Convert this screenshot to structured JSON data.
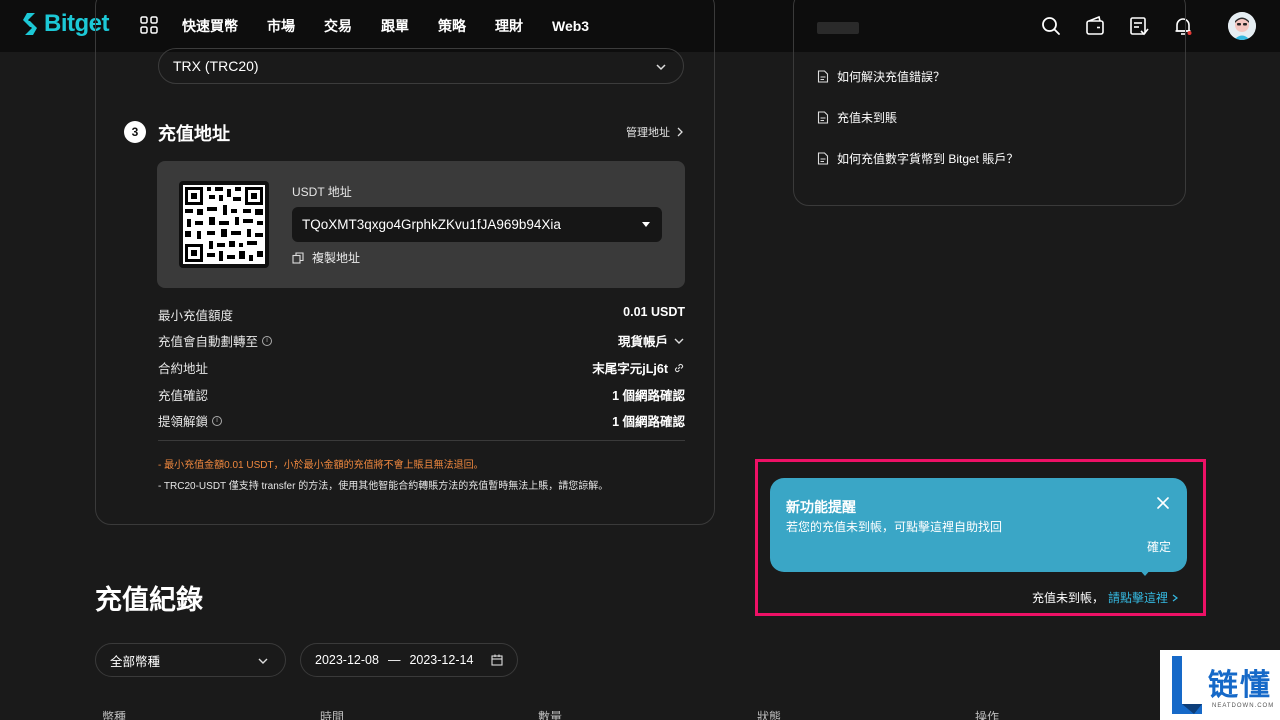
{
  "nav": {
    "logo_text": "Bitget",
    "items": [
      "快速買幣",
      "市場",
      "交易",
      "跟單",
      "策略",
      "理財",
      "Web3"
    ]
  },
  "deposit": {
    "network_value": "TRX (TRC20)",
    "step_number": "3",
    "step_title": "充值地址",
    "manage_link": "管理地址",
    "address_label": "USDT 地址",
    "address_value": "TQoXMT3qxgo4GrphkZKvu1fJA969b94Xia",
    "copy_label": "複製地址",
    "rows": [
      {
        "label": "最小充值額度",
        "value": "0.01 USDT"
      },
      {
        "label": "充值會自動劃轉至",
        "value": "現貨帳戶"
      },
      {
        "label": "合約地址",
        "value": "末尾字元jLj6t"
      },
      {
        "label": "充值確認",
        "value": "1 個網路確認"
      },
      {
        "label": "提領解鎖",
        "value": "1 個網路確認"
      }
    ],
    "note_warning": "- 最小充值金額0.01 USDT，小於最小金額的充值將不會上賬且無法退回。",
    "note_info": "- TRC20-USDT 僅支持 transfer 的方法，使用其他智能合約轉賬方法的充值暫時無法上賬，請您諒解。"
  },
  "faq": {
    "items": [
      "如何解決充值錯誤？",
      "充值未到賬",
      "如何充值數字貨幣到 Bitget 賬戶？"
    ]
  },
  "records": {
    "title": "充值紀錄",
    "coin_filter": "全部幣種",
    "date_start": "2023-12-08",
    "date_sep": "—",
    "date_end": "2023-12-14",
    "columns": [
      "幣種",
      "時間",
      "數量",
      "狀態",
      "操作"
    ]
  },
  "popover": {
    "title": "新功能提醒",
    "body": "若您的充值未到帳，可點擊這裡自助找回",
    "confirm": "確定",
    "hint_text": "充值未到帳，",
    "hint_link": "請點擊這裡"
  },
  "watermark": {
    "text": "链懂",
    "sub": "NEATDOWN.COM"
  },
  "colors": {
    "brand": "#1cc8d6",
    "popover_bg": "#3aa6c6",
    "highlight": "#ee1166",
    "warning": "#f0883e",
    "link": "#35b9e1"
  }
}
